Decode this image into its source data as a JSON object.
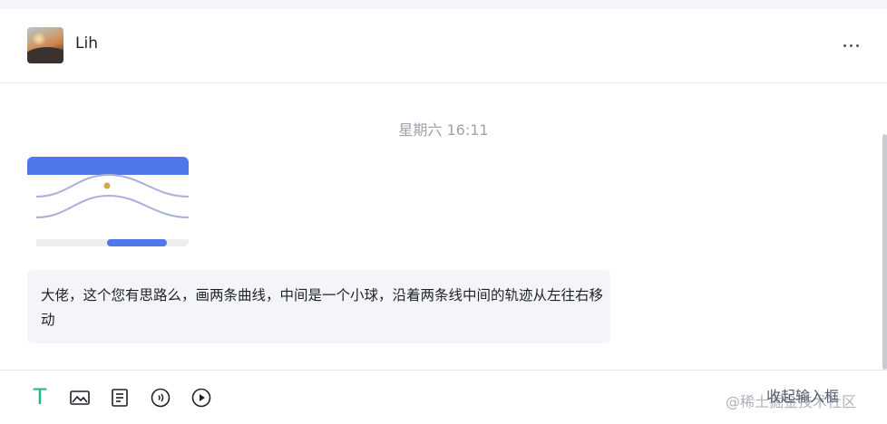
{
  "header": {
    "contact_name": "Lih",
    "more_icon": "more-horizontal-icon"
  },
  "chat": {
    "timestamp": "星期六 16:11",
    "messages": [
      {
        "type": "image",
        "description_icon": "image-thumbnail"
      },
      {
        "type": "text",
        "text": "大佬，这个您有思路么，画两条曲线，中间是一个小球，沿着两条线中间的轨迹从左往右移动"
      }
    ]
  },
  "toolbar": {
    "text_tool_glyph": "T",
    "collapse_label": "收起输入框",
    "watermark": "@稀土掘金技术社区",
    "icons": [
      "text-icon",
      "image-icon",
      "file-icon",
      "audio-icon",
      "video-icon"
    ]
  },
  "colors": {
    "accent_green": "#1fb97b",
    "image_blue": "#5077e8",
    "bubble_bg": "#f3f5f8"
  }
}
